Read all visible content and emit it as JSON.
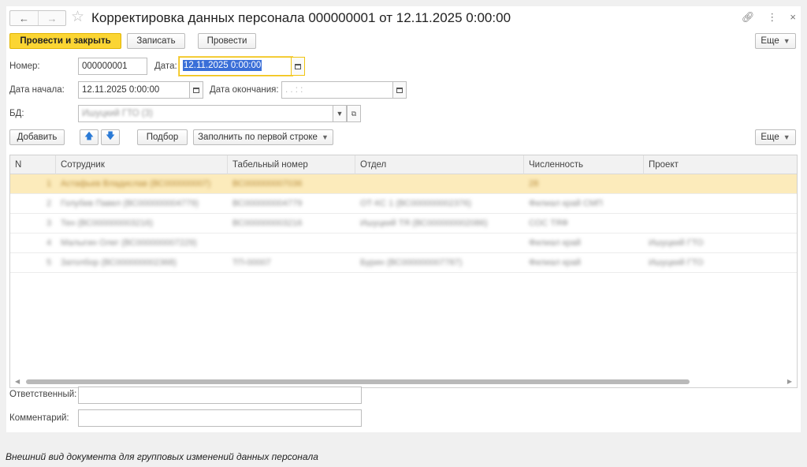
{
  "title": "Корректировка данных персонала 000000001 от 12.11.2025 0:00:00",
  "toolbar": {
    "post_close": "Провести и закрыть",
    "save": "Записать",
    "post": "Провести",
    "more": "Еще"
  },
  "form": {
    "number_label": "Номер:",
    "number_value": "000000001",
    "date_label": "Дата:",
    "date_value": "12.11.2025  0:00:00",
    "start_label": "Дата начала:",
    "start_value": "12.11.2025  0:00:00",
    "end_label": "Дата окончания:",
    "end_value": " .  .      :  :",
    "db_label": "БД:",
    "db_value": "Ишуцкий ГТО (3)"
  },
  "table_toolbar": {
    "add": "Добавить",
    "pick": "Подбор",
    "fill": "Заполнить по первой строке",
    "more": "Еще"
  },
  "table": {
    "columns": [
      "N",
      "Сотрудник",
      "Табельный номер",
      "Отдел",
      "Численность",
      "Проект"
    ],
    "rows": [
      [
        "1",
        "Астафьев Владислав (ВС000000007)",
        "ВС000000007036",
        "",
        "28",
        ""
      ],
      [
        "2",
        "Голубев Павел (ВС000000004779)",
        "ВС000000004779",
        "ОТ-КС 1 (ВС000000002376)",
        "Филиал край СМП",
        ""
      ],
      [
        "3",
        "Тен (ВС000000003216)",
        "ВС000000003216",
        "Ишуцкий ТЯ (ВС000000002086)",
        "СОС ТЯФ",
        ""
      ],
      [
        "4",
        "Малыгин Олег (ВС000000007229)",
        "",
        "",
        "Филиал край",
        "Ишуцкий ГТО"
      ],
      [
        "5",
        "Затолбор (ВС000000002368)",
        "ТП-00007",
        "Бурин (ВС000000007787)",
        "Филиал край",
        "Ишуцкий ГТО"
      ]
    ]
  },
  "footer": {
    "responsible_label": "Ответственный:",
    "comment_label": "Комментарий:"
  },
  "caption": "Внешний вид документа для групповых изменений данных персонала",
  "colors": {
    "primary_button": "#fbd533",
    "selected_row": "#fcebbb",
    "focus_border": "#f1c40f",
    "text_selection": "#3a6fd8"
  }
}
